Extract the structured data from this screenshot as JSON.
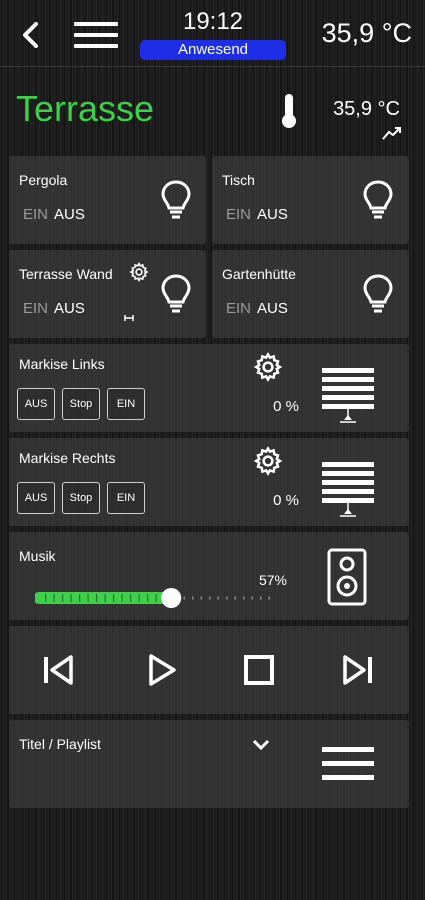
{
  "header": {
    "time": "19:12",
    "presence": "Anwesend",
    "outdoor_temp": "35,9 °C"
  },
  "room": {
    "title": "Terrasse",
    "temperature": "35,9 °C"
  },
  "lights": [
    {
      "label": "Pergola",
      "on_label": "EIN",
      "off_label": "AUS"
    },
    {
      "label": "Tisch",
      "on_label": "EIN",
      "off_label": "AUS"
    },
    {
      "label": "Terrasse Wand",
      "on_label": "EIN",
      "off_label": "AUS"
    },
    {
      "label": "Gartenhütte",
      "on_label": "EIN",
      "off_label": "AUS"
    }
  ],
  "awnings": [
    {
      "label": "Markise Links",
      "btn_off": "AUS",
      "btn_stop": "Stop",
      "btn_on": "EIN",
      "position": "0 %"
    },
    {
      "label": "Markise Rechts",
      "btn_off": "AUS",
      "btn_stop": "Stop",
      "btn_on": "EIN",
      "position": "0 %"
    }
  ],
  "music": {
    "label": "Musik",
    "volume_text": "57%",
    "volume": 0.57,
    "accent": "#3ed04a"
  },
  "playlist": {
    "label": "Titel / Playlist"
  },
  "colors": {
    "title": "#3ed04a",
    "presence_bg": "#1d2ee6",
    "tile_bg": "#3a3a3a"
  },
  "icons": [
    "back-icon",
    "menu-icon",
    "thermometer-icon",
    "trend-icon",
    "bulb-icon",
    "gear-icon",
    "day-night-icon",
    "blinds-icon",
    "speaker-icon",
    "skip-previous-icon",
    "play-icon",
    "stop-icon",
    "skip-next-icon",
    "chevron-down-icon",
    "list-icon"
  ]
}
